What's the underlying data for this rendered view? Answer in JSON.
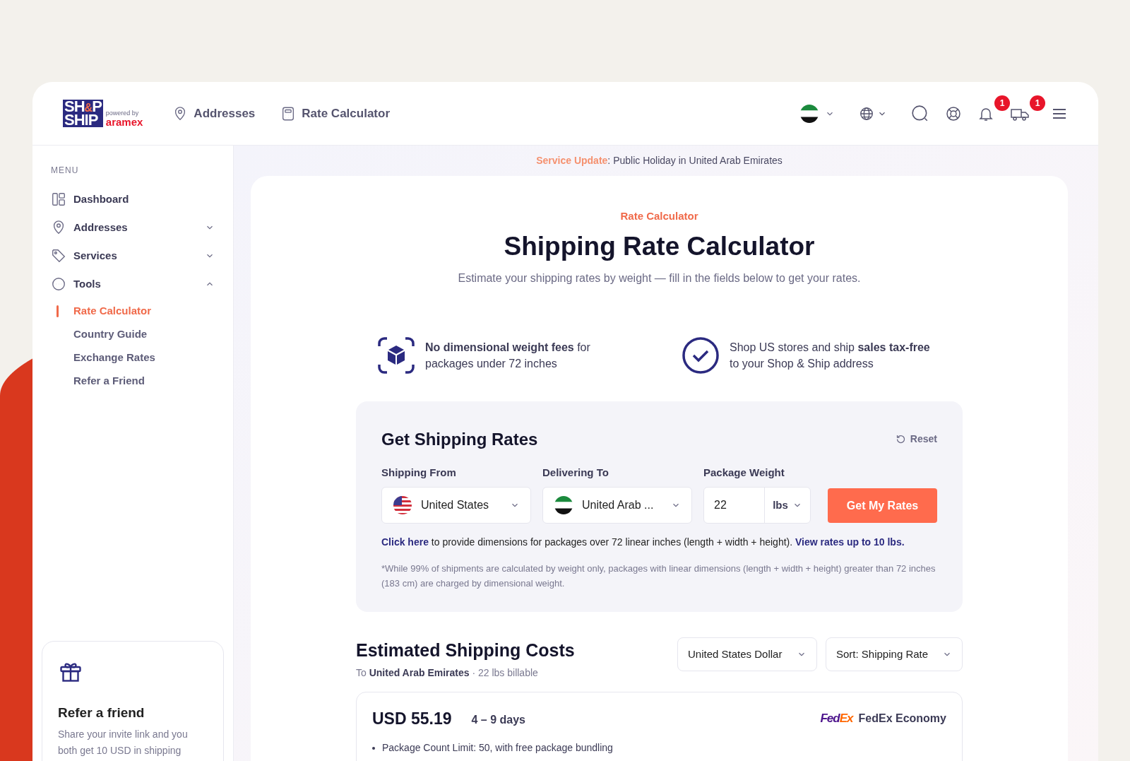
{
  "logo": {
    "top": "SH",
    "amp": "&",
    "top_end": "P",
    "bottom": "SHIP",
    "powered_by": "powered by",
    "partner": "aramex"
  },
  "top_nav": [
    {
      "kind": "pin",
      "label": "Addresses"
    },
    {
      "kind": "calculator",
      "label": "Rate Calculator"
    }
  ],
  "header": {
    "region": {
      "kind": "ae"
    },
    "notification_count": "1",
    "shipment_count": "1"
  },
  "sidebar": {
    "heading": "MENU",
    "items": [
      {
        "kind": "dashboard",
        "label": "Dashboard"
      },
      {
        "kind": "pin",
        "label": "Addresses",
        "expanded": false
      },
      {
        "kind": "tag",
        "label": "Services",
        "expanded": false
      },
      {
        "kind": "dots",
        "label": "Tools",
        "expanded": true,
        "children": [
          {
            "label": "Rate Calculator",
            "selected": true
          },
          {
            "label": "Country Guide",
            "selected": false
          },
          {
            "label": "Exchange Rates",
            "selected": false
          },
          {
            "label": "Refer a Friend",
            "selected": false
          }
        ]
      }
    ]
  },
  "refer_card": {
    "title": "Refer a friend",
    "text": "Share your invite link and you both get 10 USD in shipping"
  },
  "service_update": {
    "label": "Service Update",
    "message": ": Public Holiday in United Arab Emirates"
  },
  "page": {
    "eyebrow": "Rate Calculator",
    "title": "Shipping Rate Calculator",
    "subtitle": "Estimate your shipping rates by weight — fill in the fields below to get your rates."
  },
  "features": [
    {
      "kind": "box",
      "text": "**No dimensional weight fees** for packages under 72 inches"
    },
    {
      "kind": "check",
      "text": "Shop US stores and ship **sales tax-free** to your Shop & Ship address"
    }
  ],
  "rates_form": {
    "title": "Get Shipping Rates",
    "reset": "Reset",
    "fields": [
      {
        "label": "Shipping From",
        "value": "United States",
        "kind": "us"
      },
      {
        "label": "Delivering To",
        "value": "United Arab ...",
        "kind": "ae"
      }
    ],
    "weight": {
      "label": "Package Weight",
      "value": "22",
      "unit": "lbs"
    },
    "submit": "Get My Rates",
    "help_link": "Click here",
    "help_text": " to provide dimensions for packages over 72 linear inches (length + width + height). ",
    "rates_link": "View rates up to 10 lbs.",
    "footnote": "*While 99% of shipments are calculated by weight only, packages with linear dimensions (length + width + height) greater than 72 inches (183 cm) are charged by dimensional weight."
  },
  "results": {
    "title": "Estimated Shipping Costs",
    "prefix": "To",
    "destination": "United Arab Emirates",
    "billable": "· 22 lbs billable",
    "currency": "United States Dollar",
    "sort": "Sort: Shipping Rate",
    "rates": [
      {
        "price": "USD 55.19",
        "transit": "4 – 9 days",
        "logo_part_1": "Fed",
        "logo_part_2": "Ex",
        "service": "FedEx Economy",
        "notes": [
          "Package Count Limit: 50, with free package bundling"
        ]
      }
    ]
  }
}
